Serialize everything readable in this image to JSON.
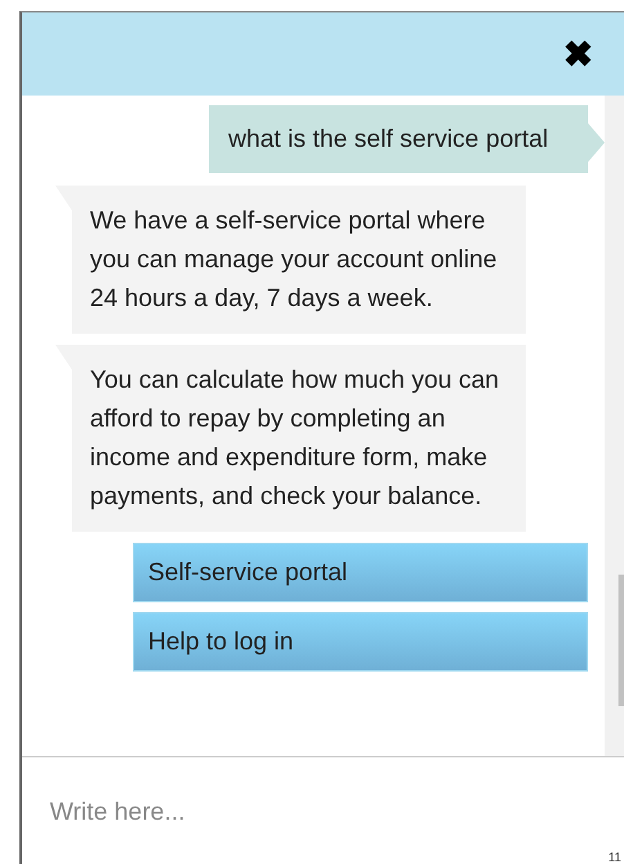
{
  "header": {
    "close_icon": "✖"
  },
  "messages": [
    {
      "kind": "user",
      "text": "what is the self service portal"
    },
    {
      "kind": "bot",
      "text": "We have a self-service portal where you can manage your account online 24 hours a day, 7 days a week."
    },
    {
      "kind": "bot",
      "text": "You can calculate how much you can afford to repay by completing an income and expenditure form, make payments, and check your balance."
    },
    {
      "kind": "option",
      "text": "Self-service portal"
    },
    {
      "kind": "option",
      "text": "Help to log in"
    }
  ],
  "composer": {
    "placeholder": "Write here..."
  },
  "corner_text": "11"
}
